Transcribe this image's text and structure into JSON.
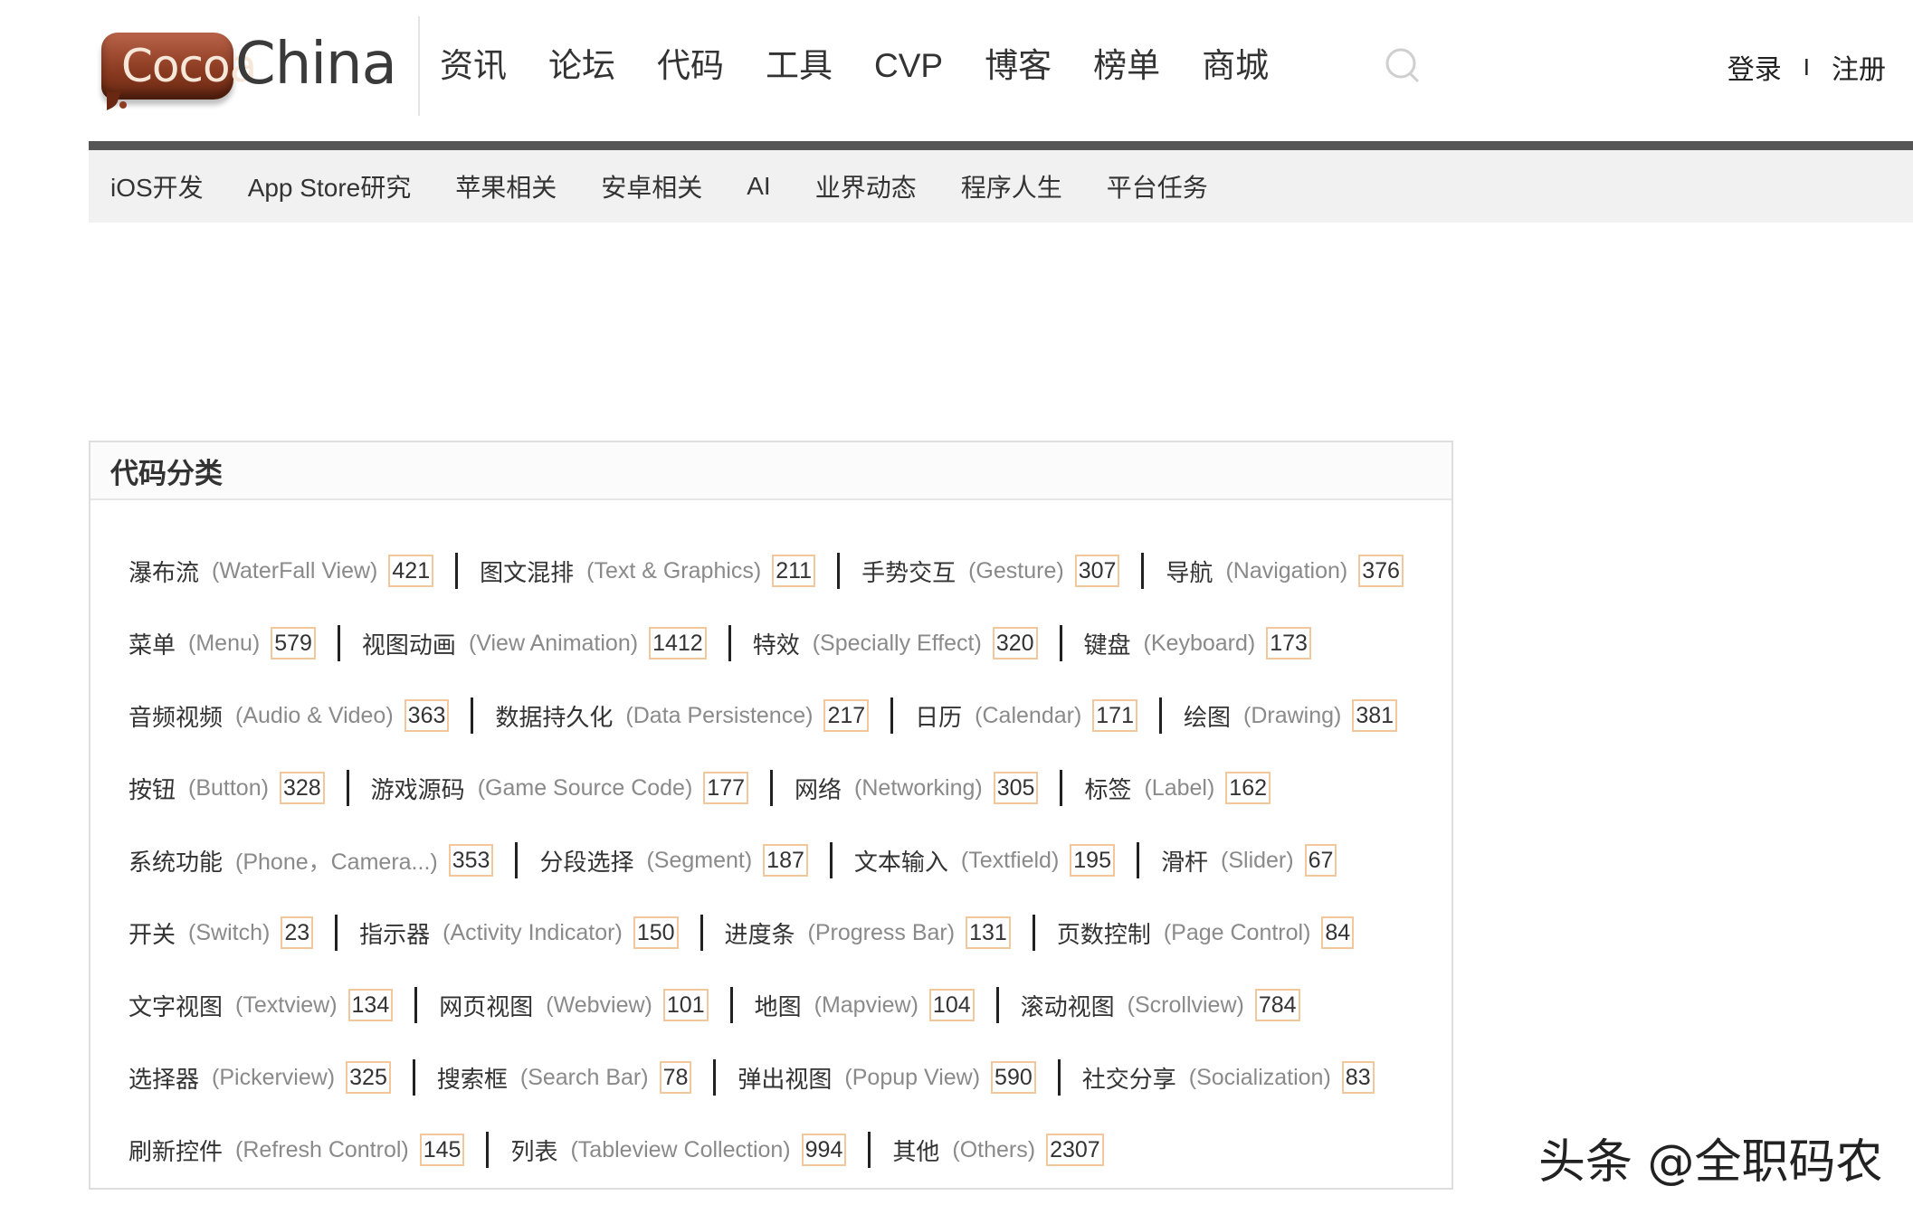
{
  "logo": {
    "badge_text": "Cocoa",
    "word": "China"
  },
  "main_nav": [
    "资讯",
    "论坛",
    "代码",
    "工具",
    "CVP",
    "博客",
    "榜单",
    "商城"
  ],
  "auth": {
    "login": "登录",
    "separator": "I",
    "register": "注册"
  },
  "sub_nav": [
    "iOS开发",
    "App Store研究",
    "苹果相关",
    "安卓相关",
    "AI",
    "业界动态",
    "程序人生",
    "平台任务"
  ],
  "panel": {
    "title": "代码分类"
  },
  "categories": [
    [
      {
        "cn": "瀑布流",
        "en": "(WaterFall View)",
        "count": "421"
      },
      {
        "cn": "图文混排",
        "en": "(Text & Graphics)",
        "count": "211"
      },
      {
        "cn": "手势交互",
        "en": "(Gesture)",
        "count": "307"
      },
      {
        "cn": "导航",
        "en": "(Navigation)",
        "count": "376"
      }
    ],
    [
      {
        "cn": "菜单",
        "en": "(Menu)",
        "count": "579"
      },
      {
        "cn": "视图动画",
        "en": "(View Animation)",
        "count": "1412"
      },
      {
        "cn": "特效",
        "en": "(Specially Effect)",
        "count": "320"
      },
      {
        "cn": "键盘",
        "en": "(Keyboard)",
        "count": "173"
      }
    ],
    [
      {
        "cn": "音频视频",
        "en": "(Audio & Video)",
        "count": "363"
      },
      {
        "cn": "数据持久化",
        "en": "(Data Persistence)",
        "count": "217"
      },
      {
        "cn": "日历",
        "en": "(Calendar)",
        "count": "171"
      },
      {
        "cn": "绘图",
        "en": "(Drawing)",
        "count": "381"
      }
    ],
    [
      {
        "cn": "按钮",
        "en": "(Button)",
        "count": "328"
      },
      {
        "cn": "游戏源码",
        "en": "(Game Source Code)",
        "count": "177"
      },
      {
        "cn": "网络",
        "en": "(Networking)",
        "count": "305"
      },
      {
        "cn": "标签",
        "en": "(Label)",
        "count": "162"
      }
    ],
    [
      {
        "cn": "系统功能",
        "en": "(Phone，Camera...)",
        "count": "353"
      },
      {
        "cn": "分段选择",
        "en": "(Segment)",
        "count": "187"
      },
      {
        "cn": "文本输入",
        "en": "(Textfield)",
        "count": "195"
      },
      {
        "cn": "滑杆",
        "en": "(Slider)",
        "count": "67"
      }
    ],
    [
      {
        "cn": "开关",
        "en": "(Switch)",
        "count": "23"
      },
      {
        "cn": "指示器",
        "en": "(Activity Indicator)",
        "count": "150"
      },
      {
        "cn": "进度条",
        "en": "(Progress Bar)",
        "count": "131"
      },
      {
        "cn": "页数控制",
        "en": "(Page Control)",
        "count": "84"
      }
    ],
    [
      {
        "cn": "文字视图",
        "en": "(Textview)",
        "count": "134"
      },
      {
        "cn": "网页视图",
        "en": "(Webview)",
        "count": "101"
      },
      {
        "cn": "地图",
        "en": "(Mapview)",
        "count": "104"
      },
      {
        "cn": "滚动视图",
        "en": "(Scrollview)",
        "count": "784"
      }
    ],
    [
      {
        "cn": "选择器",
        "en": "(Pickerview)",
        "count": "325"
      },
      {
        "cn": "搜索框",
        "en": "(Search Bar)",
        "count": "78"
      },
      {
        "cn": "弹出视图",
        "en": "(Popup View)",
        "count": "590"
      },
      {
        "cn": "社交分享",
        "en": "(Socialization)",
        "count": "83"
      }
    ],
    [
      {
        "cn": "刷新控件",
        "en": "(Refresh Control)",
        "count": "145"
      },
      {
        "cn": "列表",
        "en": "(Tableview Collection)",
        "count": "994"
      },
      {
        "cn": "其他",
        "en": "(Others)",
        "count": "2307"
      }
    ]
  ],
  "watermark": "头条 @全职码农",
  "icons": {
    "search": "search-icon"
  },
  "colors": {
    "count_border": "#f3c79c",
    "subnav_bar": "#555555",
    "logo_brown": "#8c3c22"
  }
}
